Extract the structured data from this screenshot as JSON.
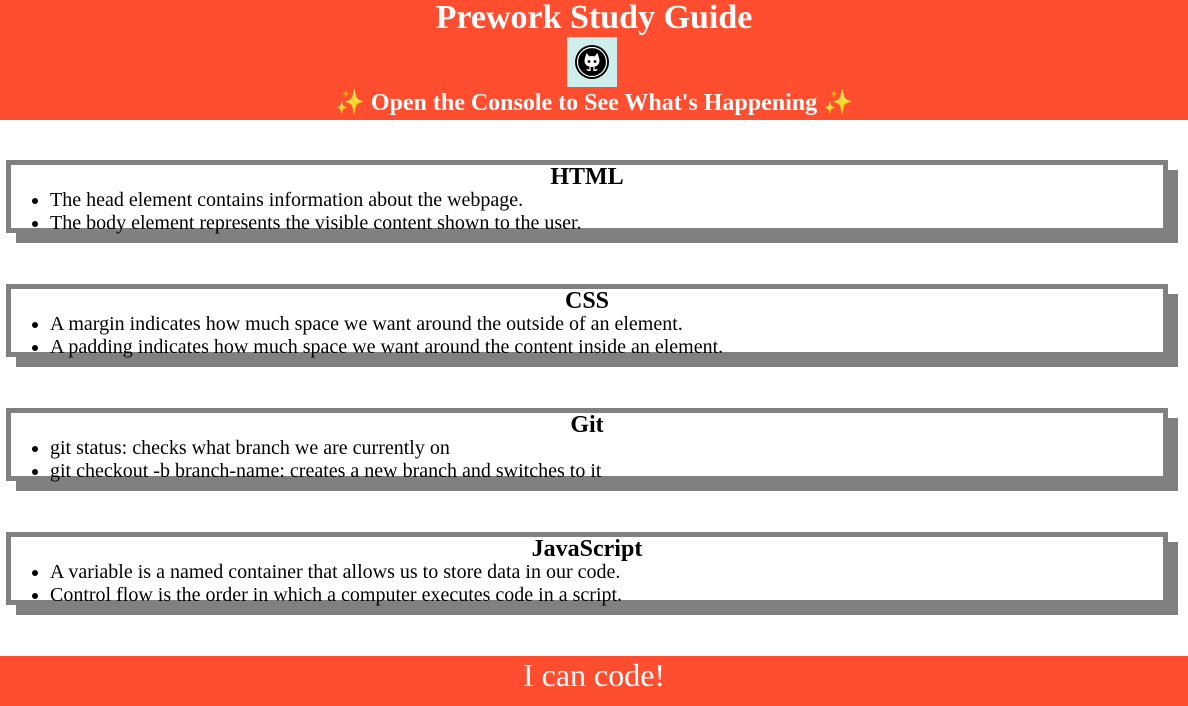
{
  "header": {
    "title": "Prework Study Guide",
    "subtitle_text": "Open the Console to See What's Happening",
    "sparkle": "✨"
  },
  "sections": [
    {
      "title": "HTML",
      "items": [
        "The head element contains information about the webpage.",
        "The body element represents the visible content shown to the user."
      ]
    },
    {
      "title": "CSS",
      "items": [
        "A margin indicates how much space we want around the outside of an element.",
        "A padding indicates how much space we want around the content inside an element."
      ]
    },
    {
      "title": "Git",
      "items": [
        "git status: checks what branch we are currently on",
        "git checkout -b branch-name: creates a new branch and switches to it"
      ]
    },
    {
      "title": "JavaScript",
      "items": [
        "A variable is a named container that allows us to store data in our code.",
        "Control flow is the order in which a computer executes code in a script."
      ]
    }
  ],
  "footer": {
    "text": "I can code!"
  },
  "colors": {
    "brand": "#ff4e2f",
    "border": "#808080",
    "logo_bg": "#cdeeed"
  }
}
